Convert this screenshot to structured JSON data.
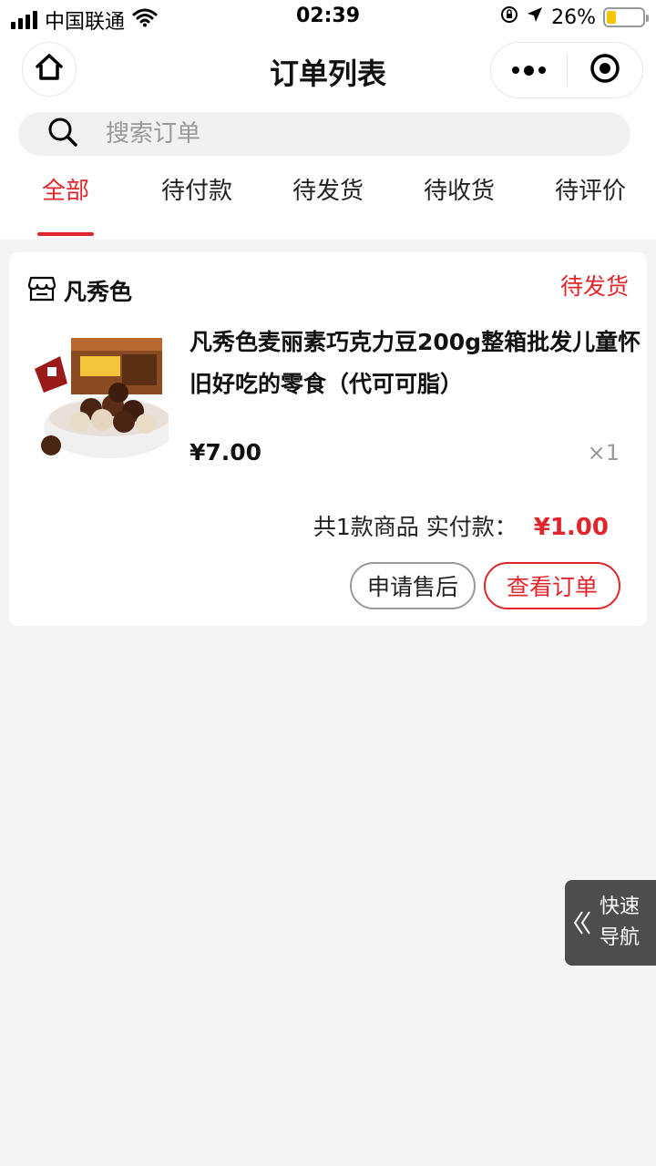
{
  "status_bar": {
    "carrier": "中国联通",
    "time": "02:39",
    "battery": "26%"
  },
  "nav": {
    "title": "订单列表"
  },
  "search": {
    "placeholder": "搜索订单"
  },
  "tabs": [
    {
      "label": "全部",
      "active": true
    },
    {
      "label": "待付款",
      "active": false
    },
    {
      "label": "待发货",
      "active": false
    },
    {
      "label": "待收货",
      "active": false
    },
    {
      "label": "待评价",
      "active": false
    }
  ],
  "order": {
    "shop_name": "凡秀色",
    "status": "待发货",
    "product": {
      "title": "凡秀色麦丽素巧克力豆200g整箱批发儿童怀旧好吃的零食（代可可脂）",
      "price": "¥7.00",
      "qty": "×1"
    },
    "summary_text": "共1款商品 实付款：",
    "paid_amount": "¥1.00",
    "buttons": {
      "after_sales": "申请售后",
      "view_order": "查看订单"
    }
  },
  "quick_nav": {
    "line1": "快速",
    "line2": "导航"
  },
  "colors": {
    "accent": "#e0252b",
    "background": "#f4f4f4",
    "quick_nav_bg": "#4d4d4d"
  }
}
